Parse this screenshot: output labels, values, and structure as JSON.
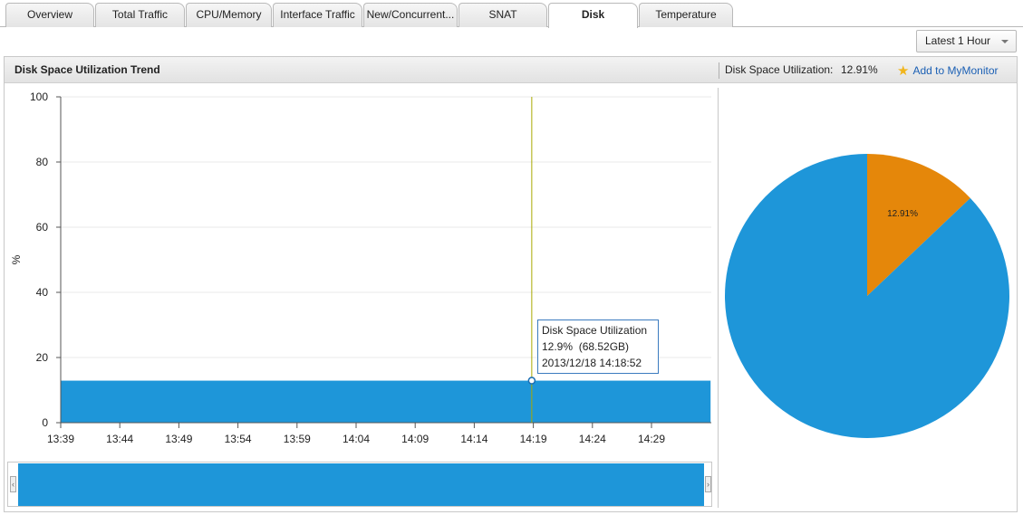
{
  "tabs": [
    "Overview",
    "Total Traffic",
    "CPU/Memory",
    "Interface Traffic",
    "New/Concurrent...",
    "SNAT",
    "Disk",
    "Temperature"
  ],
  "active_tab": "Disk",
  "time_range": "Latest 1 Hour",
  "panel": {
    "title": "Disk Space Utilization Trend",
    "utilization_label": "Disk Space Utilization:",
    "utilization_value": "12.91%",
    "add_label": "Add to MyMonitor"
  },
  "tooltip": {
    "title": "Disk Space Utilization",
    "value": "12.9%  (68.52GB)",
    "timestamp": "2013/12/18 14:18:52"
  },
  "colors": {
    "series": "#1e96d9",
    "used": "#e5870a",
    "cursor": "#a8a800"
  },
  "chart_data": [
    {
      "type": "area",
      "ylabel": "%",
      "ylim": [
        0,
        100
      ],
      "yticks": [
        0,
        20,
        40,
        60,
        80,
        100
      ],
      "xtick_labels": [
        "13:39",
        "13:44",
        "13:49",
        "13:54",
        "13:59",
        "14:04",
        "14:09",
        "14:14",
        "14:19",
        "14:24",
        "14:29"
      ],
      "series": [
        {
          "x": [
            "13:39",
            "14:34"
          ],
          "y": [
            12.9,
            12.9
          ]
        }
      ],
      "cursor": {
        "x": "14:18:52",
        "y": 12.9
      },
      "grid": true
    },
    {
      "type": "pie",
      "slices": [
        {
          "label": "12.91%",
          "value": 12.91,
          "color": "#e5870a"
        },
        {
          "label": "",
          "value": 87.09,
          "color": "#1e96d9"
        }
      ]
    }
  ]
}
